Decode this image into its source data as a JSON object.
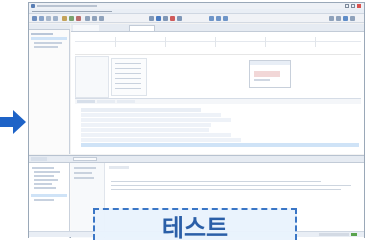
{
  "overlay": {
    "caption": "테스트",
    "accent": "#1e63c7"
  },
  "editor": {
    "tabs": [
      "",
      "",
      "",
      ""
    ],
    "sub_tabs": [
      "",
      "",
      ""
    ]
  },
  "icons": [
    "arrow-right-icon",
    "save-icon",
    "run-icon",
    "debug-icon",
    "search-icon",
    "folder-icon"
  ]
}
